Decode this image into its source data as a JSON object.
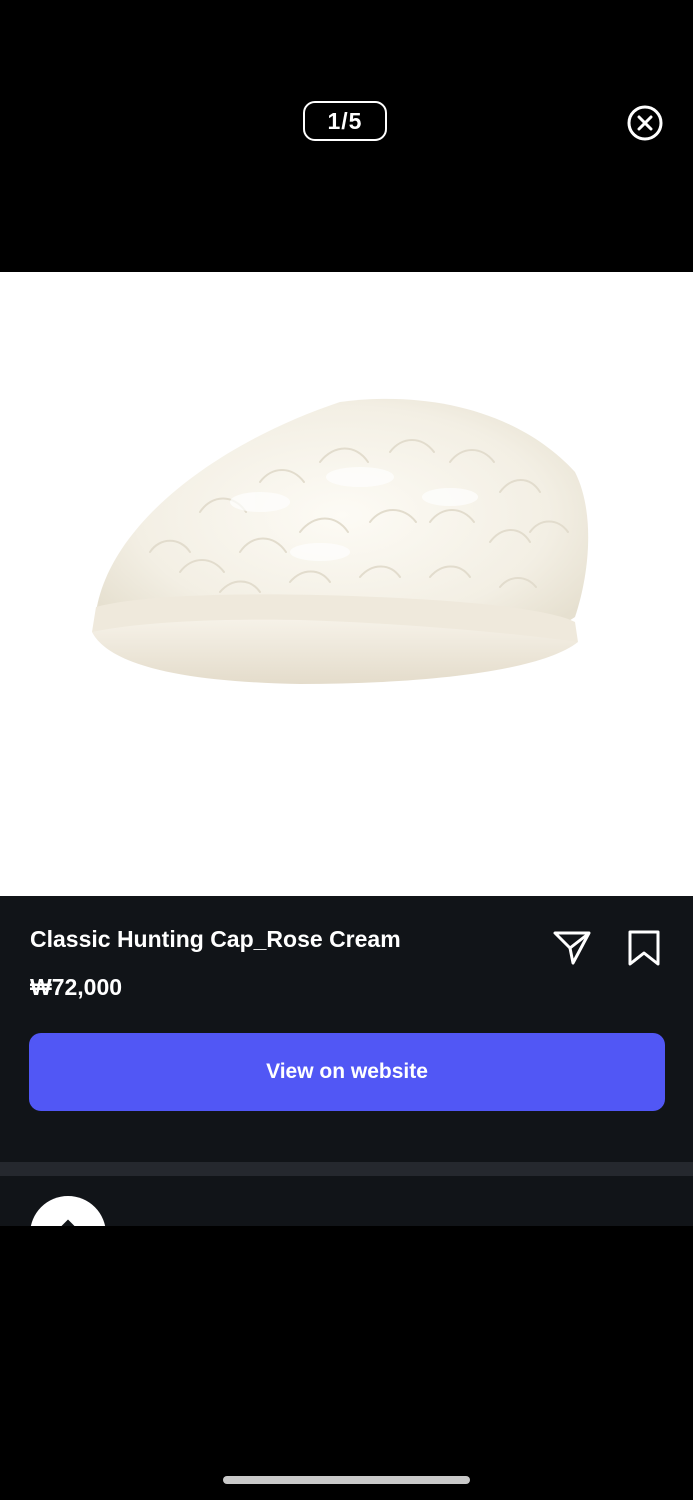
{
  "viewer": {
    "page_counter": "1/5"
  },
  "product": {
    "title": "Classic Hunting Cap_Rose Cream",
    "price": "₩72,000",
    "view_button_label": "View on website"
  },
  "icons": {
    "close": "close-circle-icon",
    "share": "send-icon",
    "bookmark": "bookmark-icon"
  },
  "colors": {
    "accent": "#5157f5",
    "panel_background": "#111418",
    "image_background": "#ffffff"
  }
}
